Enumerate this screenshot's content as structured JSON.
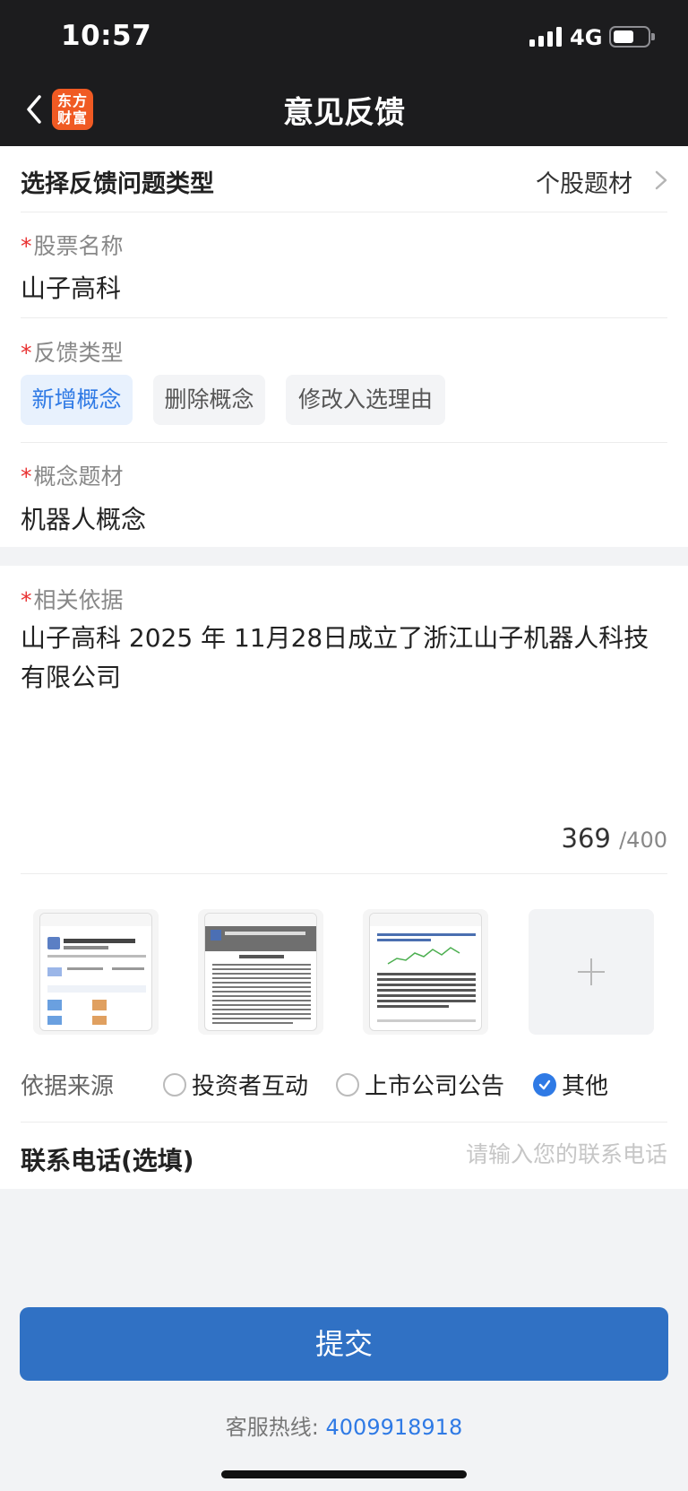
{
  "status_bar": {
    "time": "10:57",
    "network": "4G"
  },
  "nav": {
    "title": "意见反馈",
    "logo_text": "东方财富"
  },
  "feedback_type": {
    "label": "选择反馈问题类型",
    "value": "个股题材"
  },
  "stock": {
    "label": "股票名称",
    "value": "山子高科"
  },
  "feedback_kind": {
    "label": "反馈类型",
    "options": [
      "新增概念",
      "删除概念",
      "修改入选理由"
    ],
    "selected": "新增概念"
  },
  "concept": {
    "label": "概念题材",
    "value": "机器人概念"
  },
  "basis": {
    "label": "相关依据",
    "text": "山子高科 2025 年 11月28日成立了浙江山子机器人科技有限公司",
    "count": "369",
    "max": "/400"
  },
  "attachments": {
    "count": 3
  },
  "source": {
    "label": "依据来源",
    "options": [
      "投资者互动",
      "上市公司公告",
      "其他"
    ],
    "selected": "其他"
  },
  "contact": {
    "label": "联系电话(选填)",
    "placeholder": "请输入您的联系电话"
  },
  "submit_label": "提交",
  "hotline": {
    "label": "客服热线:",
    "number": "4009918918"
  },
  "colors": {
    "accent": "#3071c4",
    "link": "#2f7ae5",
    "required": "#e93030",
    "logo": "#f05a23"
  }
}
